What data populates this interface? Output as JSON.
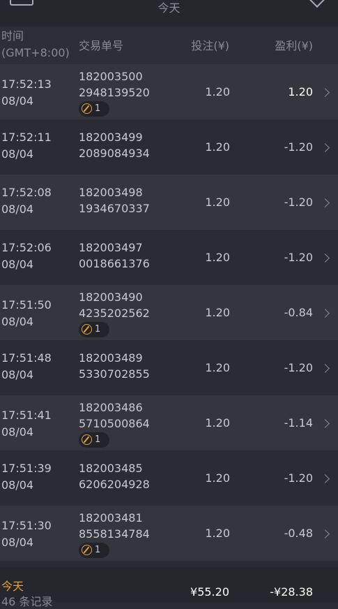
{
  "topbar": {
    "title": "今天"
  },
  "header": {
    "time_label": "时间",
    "timezone": "(GMT+8:00)",
    "order_label": "交易单号",
    "bet_label": "投注(¥)",
    "profit_label": "盈利(¥)"
  },
  "rows": [
    {
      "time": "17:52:13",
      "date": "08/04",
      "order_a": "182003500",
      "order_b": "2948139520",
      "bet": "1.20",
      "profit": "1.20",
      "badge": "1"
    },
    {
      "time": "17:52:11",
      "date": "08/04",
      "order_a": "182003499",
      "order_b": "2089084934",
      "bet": "1.20",
      "profit": "-1.20"
    },
    {
      "time": "17:52:08",
      "date": "08/04",
      "order_a": "182003498",
      "order_b": "1934670337",
      "bet": "1.20",
      "profit": "-1.20"
    },
    {
      "time": "17:52:06",
      "date": "08/04",
      "order_a": "182003497",
      "order_b": "0018661376",
      "bet": "1.20",
      "profit": "-1.20"
    },
    {
      "time": "17:51:50",
      "date": "08/04",
      "order_a": "182003490",
      "order_b": "4235202562",
      "bet": "1.20",
      "profit": "-0.84",
      "badge": "1"
    },
    {
      "time": "17:51:48",
      "date": "08/04",
      "order_a": "182003489",
      "order_b": "5330702855",
      "bet": "1.20",
      "profit": "-1.20"
    },
    {
      "time": "17:51:41",
      "date": "08/04",
      "order_a": "182003486",
      "order_b": "5710500864",
      "bet": "1.20",
      "profit": "-1.14",
      "badge": "1"
    },
    {
      "time": "17:51:39",
      "date": "08/04",
      "order_a": "182003485",
      "order_b": "6206204928",
      "bet": "1.20",
      "profit": "-1.20"
    },
    {
      "time": "17:51:30",
      "date": "08/04",
      "order_a": "182003481",
      "order_b": "8558134784",
      "bet": "1.20",
      "profit": "-0.48",
      "badge": "1"
    }
  ],
  "footer": {
    "label": "今天",
    "count": "46 条记录",
    "total_bet": "¥55.20",
    "total_profit": "-¥28.38"
  },
  "colors": {
    "accent": "#e8a23a",
    "background": "#2b2b33",
    "row_alt": "#35353e"
  }
}
